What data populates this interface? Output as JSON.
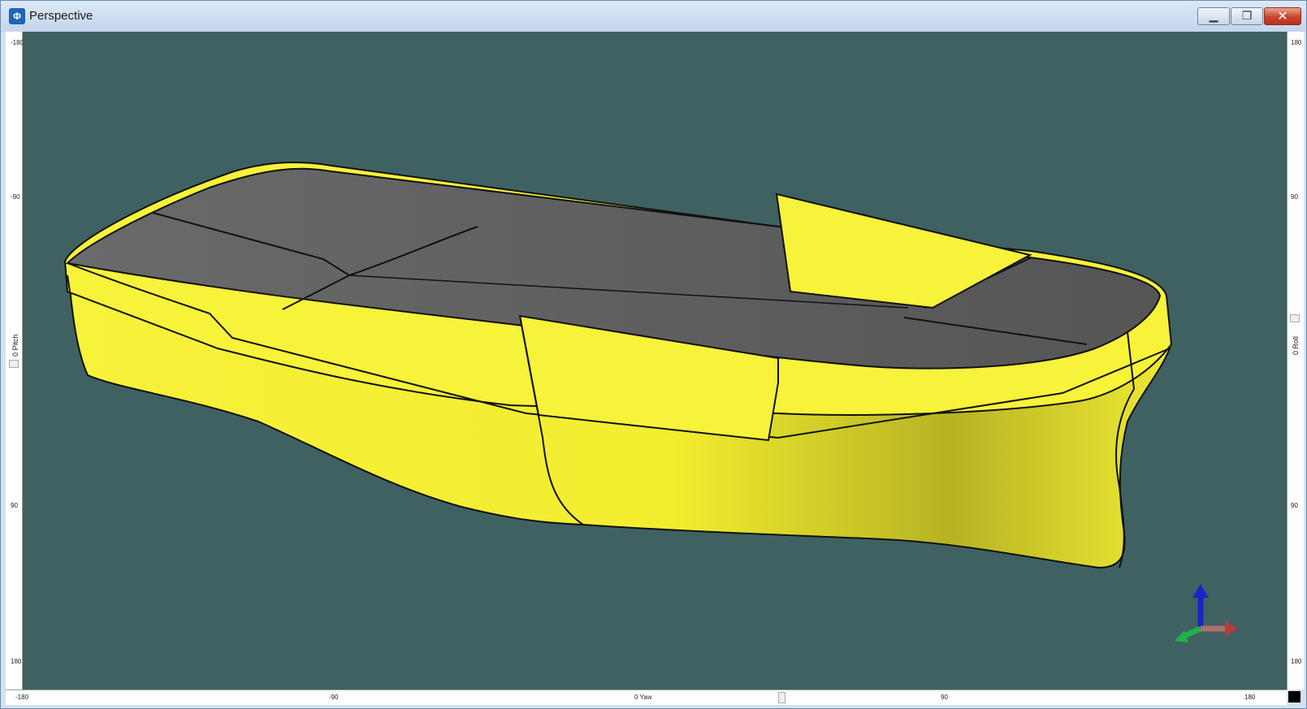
{
  "window": {
    "title": "Perspective",
    "app_icon": "app-logo-icon",
    "controls": [
      "minimize-icon",
      "maximize-icon",
      "close-icon"
    ]
  },
  "rulers": {
    "left": {
      "labels": [
        "-180",
        "-90",
        "0 Pitch",
        "90",
        "180"
      ]
    },
    "right": {
      "labels": [
        "180",
        "90",
        "0 Roll",
        "90",
        "180"
      ]
    },
    "bottom": {
      "labels": [
        "-180",
        "-90",
        "0 Yaw",
        "90",
        "180"
      ]
    }
  },
  "viewport": {
    "background": "#3f6161",
    "hull_color": "#f6f135",
    "deck_color": "#5b5b5b",
    "triad": "xyz-axis-triad-icon"
  }
}
